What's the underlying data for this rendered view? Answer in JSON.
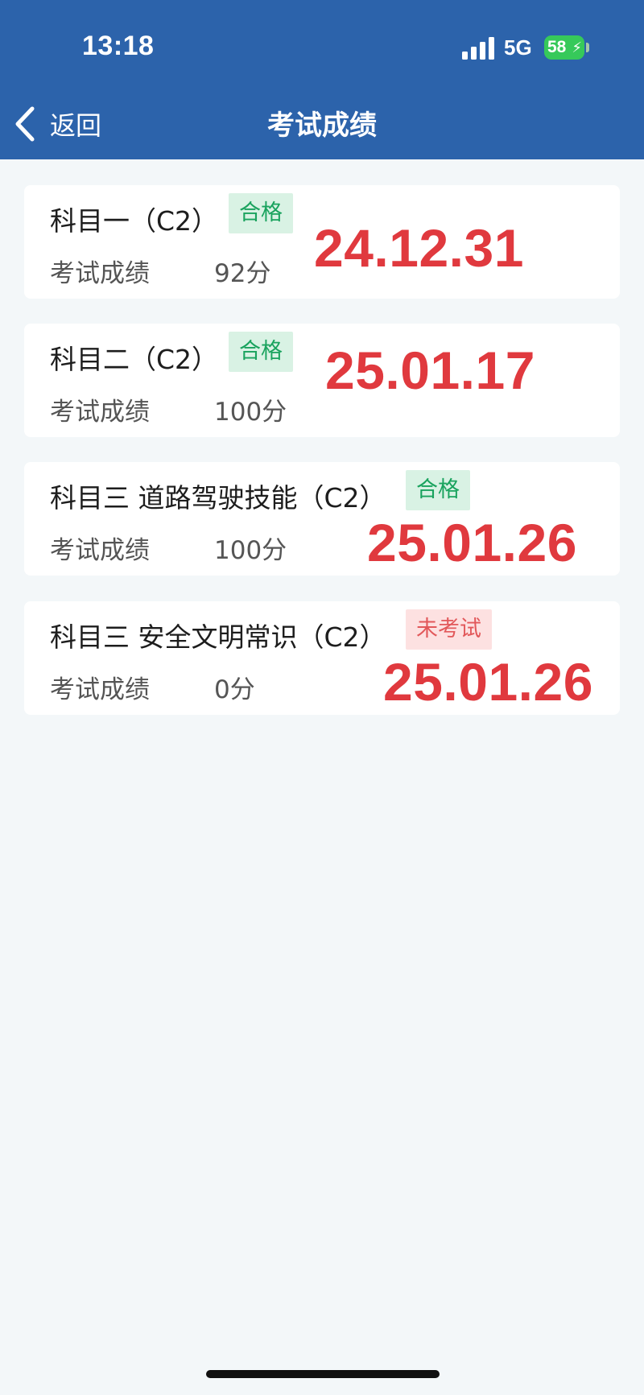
{
  "status_bar": {
    "time": "13:18",
    "network": "5G",
    "battery": "58"
  },
  "nav": {
    "back_label": "返回",
    "title": "考试成绩"
  },
  "results": [
    {
      "subject": "科目一（C2）",
      "status": "合格",
      "status_type": "pass",
      "score_label": "考试成绩",
      "score": "92分",
      "date": "24.12.31"
    },
    {
      "subject": "科目二（C2）",
      "status": "合格",
      "status_type": "pass",
      "score_label": "考试成绩",
      "score": "100分",
      "date": "25.01.17"
    },
    {
      "subject": "科目三 道路驾驶技能（C2）",
      "status": "合格",
      "status_type": "pass",
      "score_label": "考试成绩",
      "score": "100分",
      "date": "25.01.26"
    },
    {
      "subject": "科目三 安全文明常识（C2）",
      "status": "未考试",
      "status_type": "fail",
      "score_label": "考试成绩",
      "score": "0分",
      "date": "25.01.26"
    }
  ],
  "colors": {
    "header_bg": "#2c63ab",
    "pass_text": "#1aa35e",
    "pass_bg": "#d9f2e4",
    "fail_text": "#e2585a",
    "fail_bg": "#fde1e1",
    "date_red": "#e0393e"
  }
}
